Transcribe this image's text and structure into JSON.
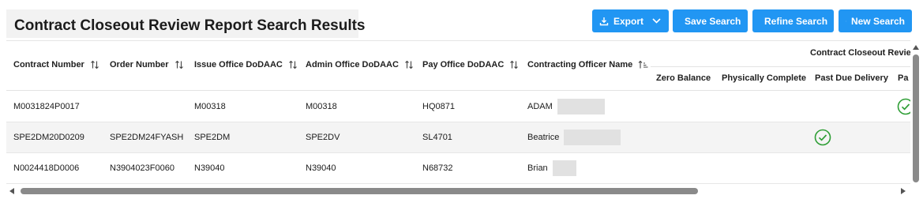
{
  "page": {
    "title": "Contract Closeout Review Report Search Results"
  },
  "toolbar": {
    "export_label": "Export",
    "save_label": "Save Search",
    "refine_label": "Refine Search",
    "new_label": "New Search"
  },
  "colors": {
    "accent": "#2196f3",
    "check": "#2e9e35"
  },
  "table": {
    "columns": {
      "contract_number": "Contract Number",
      "order_number": "Order Number",
      "issue_office": "Issue Office DoDAAC",
      "admin_office": "Admin Office DoDAAC",
      "pay_office": "Pay Office DoDAAC",
      "officer_name": "Contracting Officer Name"
    },
    "group_label": "Contract Closeout Review",
    "subcolumns": {
      "zero_balance": "Zero Balance",
      "physically_complete": "Physically Complete",
      "past_due_delivery": "Past Due Delivery",
      "partial": "Pa"
    },
    "rows": [
      {
        "contract": "M0031824P0017",
        "order": "",
        "issue": "M00318",
        "admin": "M00318",
        "pay": "HQ0871",
        "officer": "ADAM",
        "past_due_check": false,
        "partial_check": true
      },
      {
        "contract": "SPE2DM20D0209",
        "order": "SPE2DM24FYASH",
        "issue": "SPE2DM",
        "admin": "SPE2DV",
        "pay": "SL4701",
        "officer": "Beatrice",
        "past_due_check": true,
        "partial_check": false
      },
      {
        "contract": "N0024418D0006",
        "order": "N3904023F0060",
        "issue": "N39040",
        "admin": "N39040",
        "pay": "N68732",
        "officer": "Brian",
        "past_due_check": false,
        "partial_check": false
      }
    ]
  }
}
